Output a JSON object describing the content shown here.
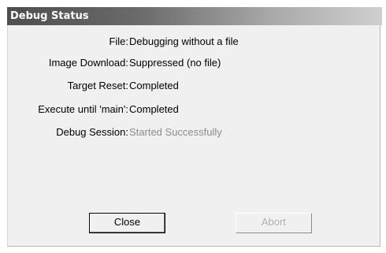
{
  "dialog": {
    "title": "Debug Status",
    "rows": [
      {
        "label": "File:",
        "value": "Debugging without a file",
        "state": "normal"
      },
      {
        "label": "Image Download:",
        "value": "Suppressed (no file)",
        "state": "normal"
      },
      {
        "label": "Target Reset:",
        "value": "Completed",
        "state": "normal"
      },
      {
        "label": "Execute until 'main':",
        "value": "Completed",
        "state": "normal"
      },
      {
        "label": "Debug Session:",
        "value": "Started Successfully",
        "state": "dim"
      }
    ],
    "buttons": {
      "close_label": "Close",
      "abort_label": "Abort",
      "abort_enabled": false
    }
  }
}
